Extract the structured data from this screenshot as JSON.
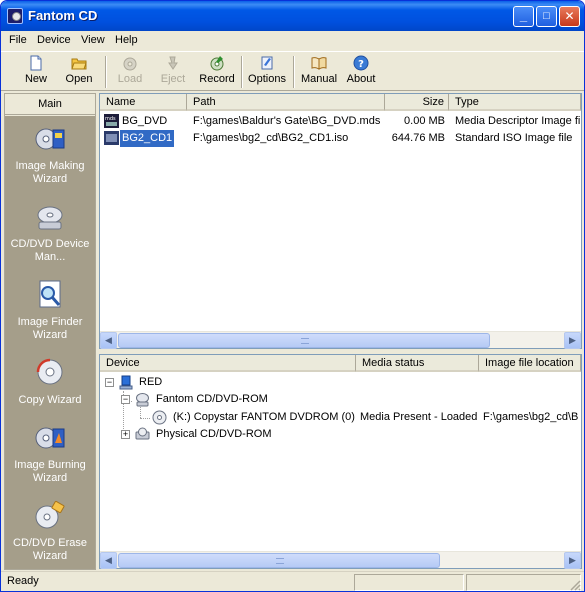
{
  "window": {
    "title": "Fantom CD",
    "minimize": "_",
    "maximize": "□",
    "close": "✕"
  },
  "menu": [
    "File",
    "Device",
    "View",
    "Help"
  ],
  "toolbar": {
    "new": "New",
    "open": "Open",
    "load": "Load",
    "eject": "Eject",
    "record": "Record",
    "options": "Options",
    "manual": "Manual",
    "about": "About"
  },
  "sidebar": {
    "header": "Main",
    "items": [
      {
        "label": "Image Making Wizard",
        "icon": "image-making-icon"
      },
      {
        "label": "CD/DVD Device Man...",
        "icon": "cd-device-manager-icon"
      },
      {
        "label": "Image Finder Wizard",
        "icon": "image-finder-icon"
      },
      {
        "label": "Copy Wizard",
        "icon": "copy-wizard-icon"
      },
      {
        "label": "Image Burning Wizard",
        "icon": "image-burning-icon"
      },
      {
        "label": "CD/DVD Erase Wizard",
        "icon": "cd-erase-icon"
      }
    ]
  },
  "files": {
    "columns": [
      "Name",
      "Path",
      "Size",
      "Type"
    ],
    "rows": [
      {
        "name": "BG_DVD",
        "path": "F:\\games\\Baldur's Gate\\BG_DVD.mds",
        "size": "0.00 MB",
        "type": "Media Descriptor Image file"
      },
      {
        "name": "BG2_CD1",
        "path": "F:\\games\\bg2_cd\\BG2_CD1.iso",
        "size": "644.76 MB",
        "type": "Standard ISO Image file"
      }
    ]
  },
  "devices": {
    "columns": [
      "Device",
      "Media status",
      "Image file location"
    ],
    "root": "RED",
    "fantom_group": "Fantom CD/DVD-ROM",
    "fantom_drive": {
      "name": "(K:) Copystar FANTOM DVDROM (0)",
      "status": "Media Present - Loaded",
      "location": "F:\\games\\bg2_cd\\B"
    },
    "physical_group": "Physical CD/DVD-ROM"
  },
  "status": {
    "text": "Ready"
  },
  "colors": {
    "title_bar": "#0054e3",
    "selection": "#316ac5",
    "sidebar_bg": "#a59e8a"
  }
}
